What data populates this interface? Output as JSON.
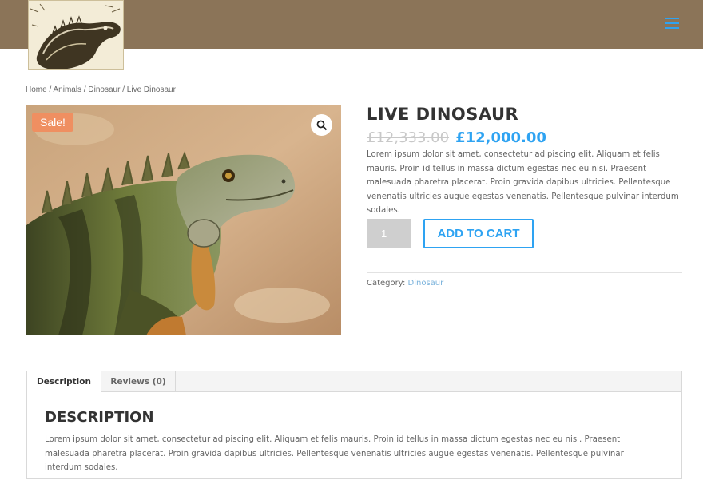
{
  "header": {
    "bg_color": "#8b7458",
    "logo_icon": "iguana-sketch-logo",
    "menu_icon": "hamburger-menu-icon"
  },
  "breadcrumb": {
    "items": [
      "Home",
      "Animals",
      "Dinosaur",
      "Live Dinosaur"
    ],
    "separator": " / "
  },
  "product": {
    "sale_badge": "Sale!",
    "zoom_icon": "magnifier-icon",
    "title": "LIVE DINOSAUR",
    "price_old": "£12,333.00",
    "price_new": "£12,000.00",
    "short_description": "Lorem ipsum dolor sit amet, consectetur adipiscing elit. Aliquam et felis mauris. Proin id tellus in massa dictum egestas nec eu nisi. Praesent malesuada pharetra placerat. Proin gravida dapibus ultricies. Pellentesque venenatis ultricies augue egestas venenatis. Pellentesque pulvinar interdum sodales.",
    "quantity": "1",
    "add_to_cart": "ADD TO CART",
    "category_label": "Category:",
    "category_value": "Dinosaur"
  },
  "tabs": {
    "items": [
      "Description",
      "Reviews (0)"
    ],
    "active": "Description",
    "heading": "DESCRIPTION",
    "text": "Lorem ipsum dolor sit amet, consectetur adipiscing elit. Aliquam et felis mauris. Proin id tellus in massa dictum egestas nec eu nisi. Praesent malesuada pharetra placerat. Proin gravida dapibus ultricies. Pellentesque venenatis ultricies augue egestas venenatis. Pellentesque pulvinar interdum sodales."
  },
  "colors": {
    "accent": "#2ea3f2",
    "sale": "#ef8f61",
    "muted_price": "#c8c8c8"
  }
}
